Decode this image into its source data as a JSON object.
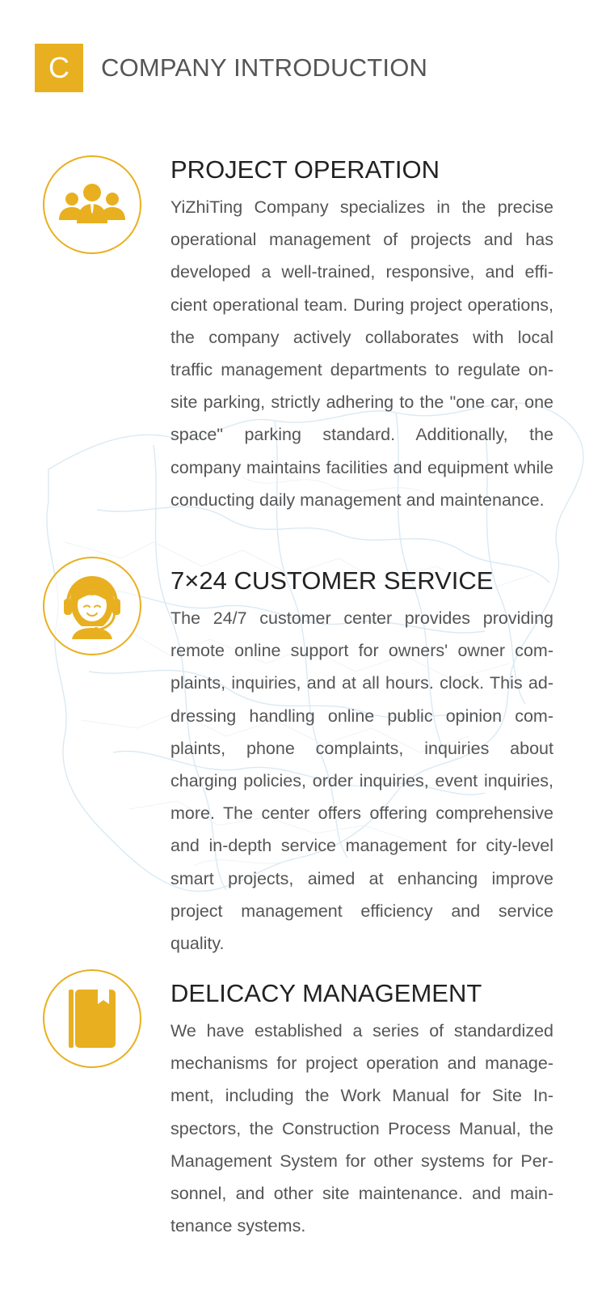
{
  "header": {
    "badge_letter": "C",
    "title": "COMPANY INTRODUCTION"
  },
  "colors": {
    "accent": "#e8b020",
    "title_text": "#222222",
    "body_text": "#555555",
    "header_text": "#555555"
  },
  "sections": [
    {
      "icon": "team-icon",
      "title": "PROJECT OPERATION",
      "text": "YiZhiTing Company specializes in the precise operational management of projects and has developed a well-trained, responsive, and effi­cient operational team. During project opera­tions, the company actively collaborates with local traffic management departments to regu­late on-site parking, strictly adhering to the \"one car, one space\" parking standard. Additionally, the company maintains facilities and equipment while conducting daily management and main­tenance."
    },
    {
      "icon": "headset-agent-icon",
      "title": "7×24  CUSTOMER SERVICE",
      "text": "The 24/7 customer center provides providing remote online support for owners' owner com­plaints, inquiries, and at all hours. clock. This ad­dressing handling online public opinion com­plaints, phone complaints, inquiries about charging policies, order inquiries, event inqui­ries, more. The center offers offering compre­hensive and in-depth service management for city-level smart projects, aimed at enhancing improve project management efficiency and service quality."
    },
    {
      "icon": "book-icon",
      "title": "DELICACY MANAGEMENT",
      "text": "We have established a series of standardized mechanisms for project operation and manage­ment, including the Work Manual for Site In­spectors, the Construction Process Manual, the Management System for other systems for Per­sonnel, and other site maintenance. and main­tenance systems."
    }
  ]
}
